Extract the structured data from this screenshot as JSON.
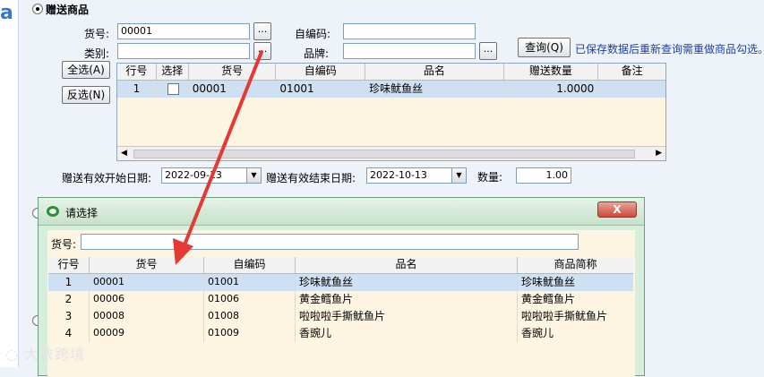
{
  "left_glyph": "a",
  "section": {
    "label": "赠送商品"
  },
  "form": {
    "item_no_label": "货号:",
    "item_no_value": "00001",
    "self_code_label": "自编码:",
    "self_code_value": "",
    "category_label": "类别:",
    "category_value": "",
    "brand_label": "品牌:",
    "brand_value": "",
    "ellipsis": "...",
    "query_button": "查询(Q)",
    "hint": "已保存数据后重新查询需重做商品勾选。"
  },
  "buttons": {
    "select_all": "全选(A)",
    "invert": "反选(N)"
  },
  "main_grid": {
    "headers": [
      "行号",
      "选择",
      "货号",
      "自编码",
      "品名",
      "赠送数量",
      "备注"
    ],
    "rows": [
      {
        "idx": "1",
        "item_no": "00001",
        "code": "01001",
        "name": "珍味鱿鱼丝",
        "qty": "1.0000",
        "note": ""
      }
    ]
  },
  "dates": {
    "start_label": "赠送有效开始日期:",
    "start_value": "2022-09-13",
    "end_label": "赠送有效结束日期:",
    "end_value": "2022-10-13",
    "qty_label": "数量:",
    "qty_value": "1.00"
  },
  "dialog": {
    "title": "请选择",
    "close": "X",
    "search_label": "货号:",
    "search_value": "",
    "headers": [
      "行号",
      "货号",
      "自编码",
      "品名",
      "商品简称"
    ],
    "rows": [
      {
        "idx": "1",
        "item_no": "00001",
        "code": "01001",
        "name": "珍味鱿鱼丝",
        "short": "珍味鱿鱼丝"
      },
      {
        "idx": "2",
        "item_no": "00006",
        "code": "01006",
        "name": "黄金鳕鱼片",
        "short": "黄金鳕鱼片"
      },
      {
        "idx": "3",
        "item_no": "00008",
        "code": "01008",
        "name": "啦啦啦手撕鱿鱼片",
        "short": "啦啦啦手撕鱿鱼片"
      },
      {
        "idx": "4",
        "item_no": "00009",
        "code": "01009",
        "name": "香豌儿",
        "short": "香豌儿"
      }
    ]
  },
  "watermark": "大数跨境",
  "colors": {
    "annotation_arrow": "#e53935",
    "selected_row": "#cfe0f2",
    "dialog_bg": "#d7eedd",
    "hint_text": "#1f3fa0"
  }
}
